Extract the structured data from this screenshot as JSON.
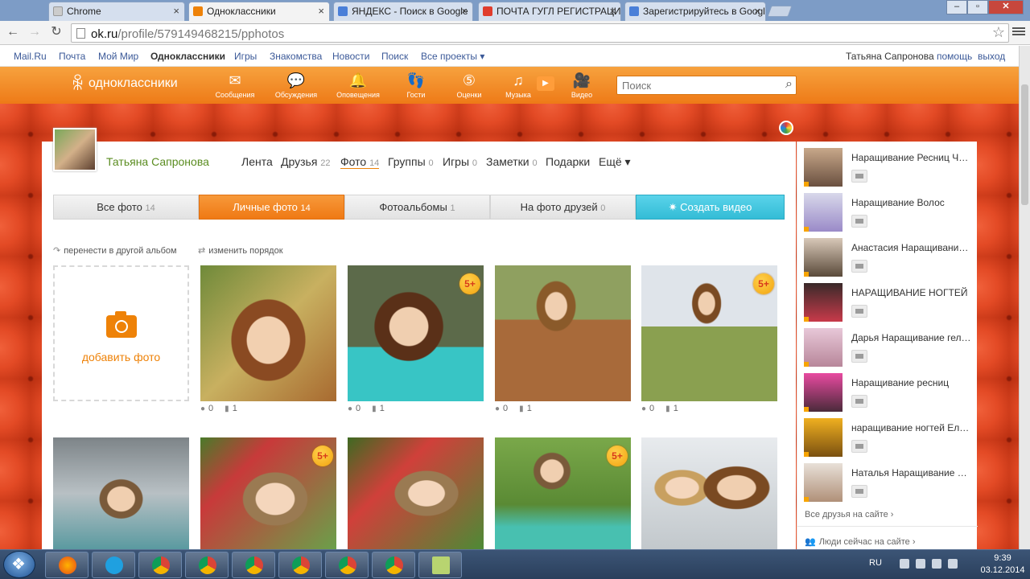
{
  "browser": {
    "tabs": [
      {
        "label": "Chrome",
        "active": false
      },
      {
        "label": "Одноклассники",
        "active": true
      },
      {
        "label": "ЯНДЕКС - Поиск в Google",
        "active": false
      },
      {
        "label": "ПОЧТА ГУГЛ РЕГИСТРАЦИЯ",
        "active": false
      },
      {
        "label": "Зарегистрируйтесь в Google",
        "active": false
      }
    ],
    "url_host": "ok.ru",
    "url_path": "/profile/579149468215/pphotos"
  },
  "portal": {
    "links": [
      "Mail.Ru",
      "Почта",
      "Мой Мир",
      "Одноклассники",
      "Игры",
      "Знакомства",
      "Новости",
      "Поиск",
      "Все проекты ▾"
    ],
    "user": "Татьяна Сапронова",
    "help": "помощь",
    "logout": "выход"
  },
  "header": {
    "logo": "одноклассники",
    "nav": [
      "Сообщения",
      "Обсуждения",
      "Оповещения",
      "Гости",
      "Оценки",
      "Музыка",
      "Видео"
    ],
    "search_placeholder": "Поиск"
  },
  "profile": {
    "name": "Татьяна Сапронова",
    "tabs": [
      {
        "label": "Лента",
        "count": ""
      },
      {
        "label": "Друзья",
        "count": "22"
      },
      {
        "label": "Фото",
        "count": "14"
      },
      {
        "label": "Группы",
        "count": "0"
      },
      {
        "label": "Игры",
        "count": "0"
      },
      {
        "label": "Заметки",
        "count": "0"
      },
      {
        "label": "Подарки",
        "count": ""
      },
      {
        "label": "Ещё ▾",
        "count": ""
      }
    ]
  },
  "photo_tabs": [
    {
      "label": "Все фото",
      "count": "14"
    },
    {
      "label": "Личные фото",
      "count": "14"
    },
    {
      "label": "Фотоальбомы",
      "count": "1"
    },
    {
      "label": "На фото друзей",
      "count": "0"
    },
    {
      "label": "✷ Создать видео",
      "count": ""
    }
  ],
  "actions": {
    "move": "перенести в другой альбом",
    "reorder": "изменить порядок"
  },
  "add_photo": "добавить фото",
  "photos_row1": [
    {
      "comments": "0",
      "likes": "1",
      "badge": ""
    },
    {
      "comments": "0",
      "likes": "1",
      "badge": "5+"
    },
    {
      "comments": "0",
      "likes": "1",
      "badge": ""
    },
    {
      "comments": "0",
      "likes": "1",
      "badge": "5+"
    }
  ],
  "photos_row2_badges": [
    "",
    "5+",
    "",
    "5+",
    ""
  ],
  "sidebar": {
    "friends": [
      "Наращивание Ресниц Чебоксары",
      "Наращивание Волос",
      "Анастасия Наращивание Ресниц",
      "НАРАЩИВАНИЕ НОГТЕЙ",
      "Дарья Наращивание гелем",
      "Наращивание ресниц",
      "наращивание ногтей Елена",
      "Наталья Наращивание ногтей"
    ],
    "all_friends": "Все друзья на сайте ›",
    "online": "Люди сейчас на сайте ›"
  },
  "taskbar": {
    "lang": "RU",
    "time": "9:39",
    "date": "03.12.2014"
  }
}
